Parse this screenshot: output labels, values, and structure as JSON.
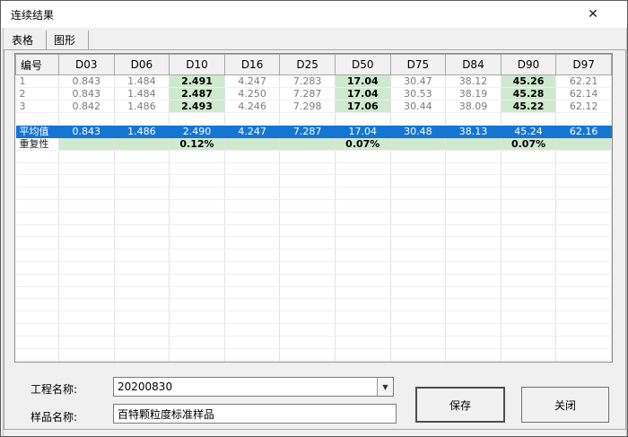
{
  "window": {
    "title": "连续结果"
  },
  "icons": {
    "close": "✕",
    "dropdown": "▼"
  },
  "tabs": [
    {
      "label": "表格",
      "active": true
    },
    {
      "label": "图形",
      "active": false
    }
  ],
  "table": {
    "columns": [
      "编号",
      "D03",
      "D06",
      "D10",
      "D16",
      "D25",
      "D50",
      "D75",
      "D84",
      "D90",
      "D97"
    ],
    "highlight_columns": [
      "D10",
      "D50",
      "D90"
    ],
    "rows": [
      {
        "label": "1",
        "values": [
          "0.843",
          "1.484",
          "2.491",
          "4.247",
          "7.283",
          "17.04",
          "30.47",
          "38.12",
          "45.26",
          "62.21"
        ]
      },
      {
        "label": "2",
        "values": [
          "0.843",
          "1.484",
          "2.487",
          "4.250",
          "7.287",
          "17.04",
          "30.53",
          "38.19",
          "45.28",
          "62.14"
        ]
      },
      {
        "label": "3",
        "values": [
          "0.842",
          "1.486",
          "2.493",
          "4.246",
          "7.298",
          "17.06",
          "30.44",
          "38.09",
          "45.22",
          "62.12"
        ]
      }
    ],
    "average_row": {
      "label": "平均值",
      "values": [
        "0.843",
        "1.486",
        "2.490",
        "4.247",
        "7.287",
        "17.04",
        "30.48",
        "38.13",
        "45.24",
        "62.16"
      ]
    },
    "repeatability_row": {
      "label": "重复性",
      "values": [
        "",
        "",
        "0.12%",
        "",
        "",
        "0.07%",
        "",
        "",
        "0.07%",
        ""
      ]
    },
    "empty_row_after_data": 1,
    "empty_rows_below": 19
  },
  "form": {
    "project_label": "工程名称:",
    "project_value": "20200830",
    "sample_label": "样品名称:",
    "sample_value": "百特颗粒度标准样品"
  },
  "buttons": {
    "save": "保存",
    "close": "关闭"
  },
  "colors": {
    "highlight_green": "#cfe9cf",
    "average_blue": "#1575d3",
    "dialog_background": "#f0f0f0",
    "titlebar_background": "#ffffff"
  }
}
